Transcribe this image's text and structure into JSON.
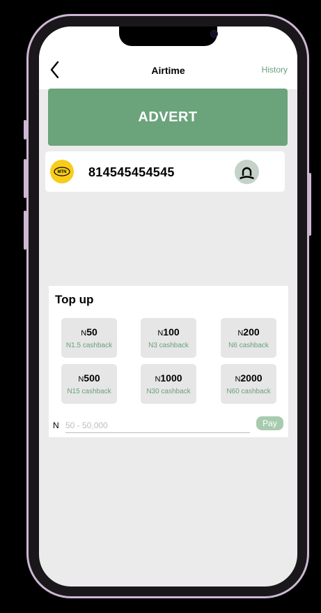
{
  "header": {
    "title": "Airtime",
    "history_label": "History",
    "back_icon": "chevron-left-icon"
  },
  "advert": {
    "label": "ADVERT"
  },
  "recipient": {
    "network": "MTN",
    "network_color": "#f8cc1b",
    "phone_number": "814545454545",
    "contact_icon": "contact-icon"
  },
  "topup": {
    "title": "Top up",
    "currency_symbol": "N",
    "options": [
      {
        "amount": "50",
        "cashback": "N1.5 cashback"
      },
      {
        "amount": "100",
        "cashback": "N3 cashback"
      },
      {
        "amount": "200",
        "cashback": "N6 cashback"
      },
      {
        "amount": "500",
        "cashback": "N15 cashback"
      },
      {
        "amount": "1000",
        "cashback": "N30 cashback"
      },
      {
        "amount": "2000",
        "cashback": "N60 cashback"
      }
    ],
    "custom_currency": "N",
    "custom_placeholder": "50 - 50,000",
    "pay_label": "Pay"
  },
  "colors": {
    "accent_green": "#6ba37b",
    "cashback_green": "#6aa07a",
    "pay_button": "#a8cbb0",
    "device_frame": "#cdb7d3"
  }
}
